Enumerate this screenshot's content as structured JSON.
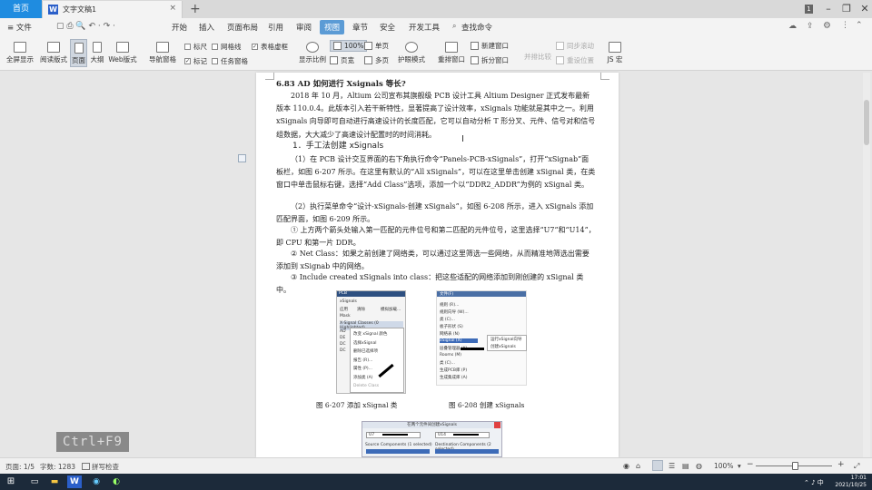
{
  "titlebar": {
    "home_tab": "首页",
    "doc_tab": "文字文稿1",
    "doc_icon_letter": "W",
    "close_glyph": "×",
    "new_tab_glyph": "+",
    "win_badge": "1"
  },
  "menu": {
    "file": "≡ 文件",
    "items": [
      "开始",
      "插入",
      "页面布局",
      "引用",
      "审阅",
      "视图",
      "章节",
      "安全",
      "开发工具"
    ],
    "active_index": 5,
    "search": "查找命令"
  },
  "ribbon": {
    "fullscreen": "全屏显示",
    "reading": "阅读版式",
    "page": "页面",
    "outline": "大纲",
    "web": "Web版式",
    "nav": "导航窗格",
    "ruler": "标尺",
    "gridlines": "网格线",
    "tableframe": "表格虚框",
    "mark": "标记",
    "taskpane": "任务窗格",
    "zoom": "显示比例",
    "zoom100": "100%",
    "onepage": "单页",
    "pagewidth": "页宽",
    "multipage": "多页",
    "eyeprotect": "护眼模式",
    "arrange": "重排窗口",
    "newwindow": "新建窗口",
    "split": "拆分窗口",
    "sync_scroll": "同步滚动",
    "side_by_side": "并排比较",
    "reset_pos": "重设位置",
    "js_macro": "JS 宏"
  },
  "document": {
    "heading": "6.83    AD 如何进行 Xsignals 等长?",
    "para1": "2018 年 10 月，Altium 公司宣布其旗舰级 PCB 设计工具 Altium Designer 正式发布最新版本 110.0.4。此版本引入若干新特性，显著提高了设计效率，xSignals 功能就是其中之一。利用 xSignals 向导即可自动进行高速设计的长度匹配，它可以自动分析 T 形分叉、元件、信号对和信号组数据，大大减少了高速设计配置时的时间消耗。",
    "sub1": "1．手工法创建 xSignals",
    "para2": "（1）在 PCB 设计交互界面的右下角执行命令“Panels-PCB-xSignals”，打开“xSignab”面板栏，如图 6-207 所示。在这里有默认的“All xSignals”，可以在这里单击创建 xSignal 类，在类窗口中单击鼠标右键，选择“Add Class”选项，添加一个以“DDR2_ADDR”为例的 xSignal 类。",
    "para3": "（2）执行菜单命令“设计-xSignals-创建 xSignals”，如图 6-208 所示，进入 xSignals 添加匹配界面，如图 6-209 所示。",
    "para4": "① 上方两个箭头处输入第一匹配的元件位号和第二匹配的元件位号，这里选择“U7”和“U14”，即 CPU 和第一片 DDR。",
    "para5": "② Net Class：如果之前创建了网络类，可以通过这里筛选一些网络，从而精准地筛选出需要添加到 xSignab 中的网络。",
    "para6": "③ Include created xSignals into class：把这些适配的网络添加到刚创建的 xSignal 类中。",
    "caption207": "图 6-207    添加 xSignal 类",
    "caption208": "图 6-208    创建 xSignals",
    "fig207": {
      "title": "PCB",
      "tab": "xSignals",
      "button1": "应用",
      "button2": "清除",
      "button3": "模拟加载...",
      "mask": "Mask",
      "class_header": "X-Signal Classes (0 Highlighted)",
      "items": [
        "AD",
        "DE",
        "DC",
        "DC"
      ],
      "menu": [
        "改变 xSignal 颜色",
        "选择xSignal",
        "删除已选择项",
        "报告 (R)...",
        "属性 (P)...",
        "添加类 (A)",
        "Delete Class"
      ]
    },
    "fig208": {
      "menu_top": [
        "文件(F)",
        "编辑",
        "视图",
        "工程"
      ],
      "items": [
        "规则 (R)...",
        "规则向导 (W)...",
        "类 (C)...",
        "板子形状 (S)",
        "网络表 (N)",
        "xSignal (X)",
        "层叠管理器 (K)...",
        "Rooms (M)",
        "类 (C)...",
        "生成PCB库 (P)",
        "生成集成库 (A)"
      ],
      "sub": [
        "运行xSignal向导",
        "创建xSignals"
      ]
    },
    "fig209": {
      "title": "在两个元件间创建xSignals",
      "input1": "U7",
      "input2": "U14",
      "left_label": "Source Components (1 selected)",
      "right_label": "Destination Components (2 selected)"
    }
  },
  "overlay": {
    "ctrl_f9": "Ctrl+F9"
  },
  "status": {
    "page": "页面: 1/5",
    "words": "字数: 1283",
    "spell": "拼写检查",
    "zoom": "100%"
  },
  "taskbar": {
    "time": "17:01",
    "date": "2021/10/25"
  }
}
